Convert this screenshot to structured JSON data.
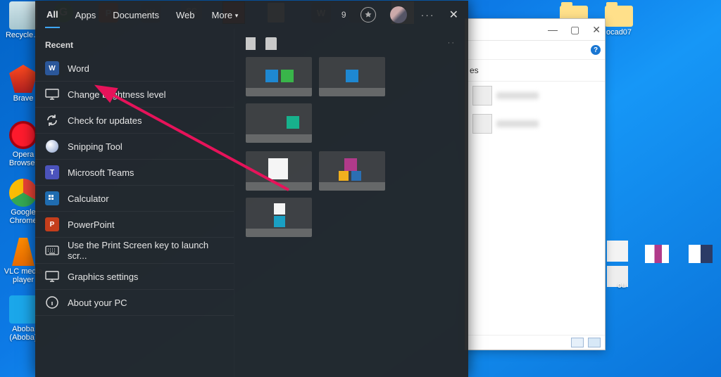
{
  "desktop_icons": {
    "recycle": {
      "label": "Recycle…"
    },
    "brave": {
      "label": "Brave"
    },
    "opera": {
      "label": "Opera Browser"
    },
    "chrome": {
      "label": "Google Chrome"
    },
    "vlc": {
      "label": "VLC media player"
    },
    "aboba": {
      "label": "Aboba (Aboba)"
    },
    "folder_mid": {
      "label": ""
    },
    "folder_r": {
      "label": "ocad07"
    },
    "occ1": {
      "label": "ou"
    },
    "occ2": {
      "label": ""
    }
  },
  "explorer": {
    "minimize": "—",
    "maximize": "▢",
    "close": "✕",
    "help": "?",
    "left_label": "es"
  },
  "search": {
    "tabs": [
      "All",
      "Apps",
      "Documents",
      "Web",
      "More"
    ],
    "tab_chevron": "▾",
    "rewards_count": "9",
    "more_dots": "···",
    "close": "✕",
    "recent_header": "Recent",
    "recent": [
      {
        "icon": "word",
        "label": "Word"
      },
      {
        "icon": "monitor",
        "label": "Change brightness level"
      },
      {
        "icon": "refresh",
        "label": "Check for updates"
      },
      {
        "icon": "snip",
        "label": "Snipping Tool"
      },
      {
        "icon": "teams",
        "label": "Microsoft Teams"
      },
      {
        "icon": "calc",
        "label": "Calculator"
      },
      {
        "icon": "ppt",
        "label": "PowerPoint"
      },
      {
        "icon": "keyboard",
        "label": "Use the Print Screen key to launch scr..."
      },
      {
        "icon": "monitor",
        "label": "Graphics settings"
      },
      {
        "icon": "info",
        "label": "About your PC"
      }
    ],
    "right_dots": "··"
  }
}
